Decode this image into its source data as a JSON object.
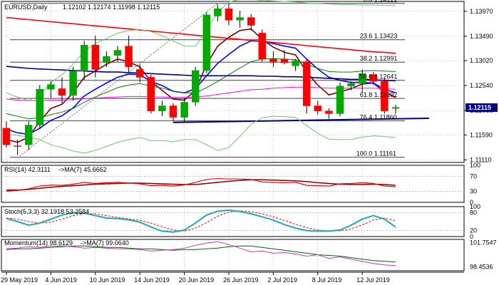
{
  "header": {
    "symbol": "EURUSD,Daily",
    "ohlc": "1.12102 1.12174 1.11998 1.12115"
  },
  "chart_data": {
    "type": "candlestick",
    "main": {
      "ylim": [
        1.1106,
        1.1416
      ],
      "price_ticks": [
        "1.13970",
        "1.13490",
        "1.13020",
        "1.12540",
        "1.12060",
        "1.11590",
        "1.11110"
      ],
      "last_price": "1.12115",
      "fibonacci": [
        {
          "label": "0.0 1.14122",
          "value": 1.14122
        },
        {
          "label": "23.6 1.13423",
          "value": 1.13423
        },
        {
          "label": "38.2 1.12991",
          "value": 1.12991
        },
        {
          "label": "50.0 1.12641",
          "value": 1.12641
        },
        {
          "label": "61.8 1.12292",
          "value": 1.12292
        },
        {
          "label": "76.4 1.11860",
          "value": 1.1186
        },
        {
          "label": "100.0 1.11161",
          "value": 1.11161
        }
      ],
      "candles": [
        {
          "o": 1.1172,
          "h": 1.1185,
          "l": 1.1135,
          "c": 1.114
        },
        {
          "o": 1.1138,
          "h": 1.115,
          "l": 1.112,
          "c": 1.1137
        },
        {
          "o": 1.114,
          "h": 1.1185,
          "l": 1.113,
          "c": 1.1178
        },
        {
          "o": 1.1178,
          "h": 1.1255,
          "l": 1.117,
          "c": 1.1247
        },
        {
          "o": 1.1247,
          "h": 1.1262,
          "l": 1.123,
          "c": 1.1256
        },
        {
          "o": 1.1248,
          "h": 1.127,
          "l": 1.122,
          "c": 1.1235
        },
        {
          "o": 1.1235,
          "h": 1.129,
          "l": 1.1225,
          "c": 1.1282
        },
        {
          "o": 1.1282,
          "h": 1.134,
          "l": 1.1265,
          "c": 1.1332
        },
        {
          "o": 1.1332,
          "h": 1.135,
          "l": 1.127,
          "c": 1.1285
        },
        {
          "o": 1.13,
          "h": 1.132,
          "l": 1.129,
          "c": 1.131
        },
        {
          "o": 1.1312,
          "h": 1.133,
          "l": 1.13,
          "c": 1.1322
        },
        {
          "o": 1.133,
          "h": 1.135,
          "l": 1.128,
          "c": 1.129
        },
        {
          "o": 1.1285,
          "h": 1.1295,
          "l": 1.126,
          "c": 1.127
        },
        {
          "o": 1.127,
          "h": 1.1275,
          "l": 1.12,
          "c": 1.1205
        },
        {
          "o": 1.1205,
          "h": 1.1225,
          "l": 1.1195,
          "c": 1.1215
        },
        {
          "o": 1.1215,
          "h": 1.122,
          "l": 1.1185,
          "c": 1.1193
        },
        {
          "o": 1.1193,
          "h": 1.123,
          "l": 1.1185,
          "c": 1.1222
        },
        {
          "o": 1.1222,
          "h": 1.129,
          "l": 1.1215,
          "c": 1.1283
        },
        {
          "o": 1.1283,
          "h": 1.1395,
          "l": 1.1278,
          "c": 1.139
        },
        {
          "o": 1.1388,
          "h": 1.141,
          "l": 1.1378,
          "c": 1.1402
        },
        {
          "o": 1.1402,
          "h": 1.1412,
          "l": 1.137,
          "c": 1.138
        },
        {
          "o": 1.138,
          "h": 1.1398,
          "l": 1.1365,
          "c": 1.1385
        },
        {
          "o": 1.1385,
          "h": 1.1392,
          "l": 1.136,
          "c": 1.137
        },
        {
          "o": 1.1355,
          "h": 1.1362,
          "l": 1.13,
          "c": 1.1305
        },
        {
          "o": 1.1305,
          "h": 1.132,
          "l": 1.129,
          "c": 1.13
        },
        {
          "o": 1.1305,
          "h": 1.1322,
          "l": 1.1295,
          "c": 1.1298
        },
        {
          "o": 1.1292,
          "h": 1.1305,
          "l": 1.1282,
          "c": 1.1302
        },
        {
          "o": 1.13,
          "h": 1.1305,
          "l": 1.12,
          "c": 1.1215
        },
        {
          "o": 1.1215,
          "h": 1.1225,
          "l": 1.1198,
          "c": 1.1205
        },
        {
          "o": 1.1205,
          "h": 1.121,
          "l": 1.119,
          "c": 1.12
        },
        {
          "o": 1.12,
          "h": 1.126,
          "l": 1.1195,
          "c": 1.1253
        },
        {
          "o": 1.1253,
          "h": 1.1262,
          "l": 1.1245,
          "c": 1.1258
        },
        {
          "o": 1.1258,
          "h": 1.1285,
          "l": 1.124,
          "c": 1.1277
        },
        {
          "o": 1.1275,
          "h": 1.128,
          "l": 1.1255,
          "c": 1.1262
        },
        {
          "o": 1.1262,
          "h": 1.1268,
          "l": 1.12,
          "c": 1.1205
        },
        {
          "o": 1.121,
          "h": 1.1217,
          "l": 1.12,
          "c": 1.1212
        }
      ],
      "lines": [
        {
          "name": "ema5",
          "color": "#800000",
          "values": [
            1.115,
            1.1145,
            1.1155,
            1.1185,
            1.121,
            1.1218,
            1.124,
            1.127,
            1.1282,
            1.1295,
            1.1305,
            1.13,
            1.129,
            1.1262,
            1.1245,
            1.1228,
            1.1226,
            1.1245,
            1.1295,
            1.133,
            1.1347,
            1.136,
            1.1363,
            1.1343,
            1.1328,
            1.1318,
            1.1313,
            1.128,
            1.1255,
            1.1236,
            1.1242,
            1.1248,
            1.1257,
            1.1259,
            1.1241,
            1.1231
          ]
        },
        {
          "name": "ema10",
          "color": "#0000ff",
          "values": [
            1.117,
            1.1163,
            1.116,
            1.1172,
            1.1187,
            1.1196,
            1.1211,
            1.1234,
            1.1247,
            1.1259,
            1.127,
            1.1276,
            1.1275,
            1.1262,
            1.1254,
            1.1243,
            1.124,
            1.1248,
            1.1273,
            1.1297,
            1.1314,
            1.133,
            1.134,
            1.1339,
            1.1335,
            1.133,
            1.1326,
            1.1305,
            1.1286,
            1.127,
            1.1264,
            1.126,
            1.126,
            1.1259,
            1.1247,
            1.124
          ]
        },
        {
          "name": "sma20",
          "color": "#008000",
          "values": [
            1.12,
            1.1195,
            1.119,
            1.1192,
            1.1198,
            1.1203,
            1.121,
            1.1222,
            1.1232,
            1.1241,
            1.125,
            1.1255,
            1.1258,
            1.1253,
            1.1249,
            1.1243,
            1.124,
            1.124,
            1.125,
            1.1262,
            1.1275,
            1.1288,
            1.13,
            1.1305,
            1.1306,
            1.1305,
            1.1304,
            1.1295,
            1.1287,
            1.1281,
            1.128,
            1.128,
            1.1282,
            1.1283,
            1.1282,
            1.1281
          ]
        },
        {
          "name": "ema55",
          "color": "#ff00ff",
          "values": [
            1.1228,
            1.1226,
            1.1225,
            1.1225,
            1.1226,
            1.1226,
            1.1227,
            1.1229,
            1.123,
            1.1231,
            1.1232,
            1.1233,
            1.1233,
            1.1232,
            1.1232,
            1.1231,
            1.1231,
            1.1232,
            1.1234,
            1.1237,
            1.124,
            1.1243,
            1.1246,
            1.1247,
            1.1249,
            1.125,
            1.1251,
            1.1251,
            1.125,
            1.1249,
            1.1249,
            1.1249,
            1.1249,
            1.1249,
            1.1248,
            1.1247
          ]
        },
        {
          "name": "ema100",
          "color": "#000080",
          "values": [
            1.1291,
            1.1289,
            1.1287,
            1.1286,
            1.1285,
            1.1284,
            1.1283,
            1.1282,
            1.1281,
            1.128,
            1.128,
            1.1279,
            1.1278,
            1.1277,
            1.1276,
            1.1275,
            1.1274,
            1.1273,
            1.1273,
            1.1273,
            1.1273,
            1.1273,
            1.1273,
            1.1272,
            1.1272,
            1.1271,
            1.1271,
            1.127,
            1.1269,
            1.1268,
            1.1267,
            1.1266,
            1.1266,
            1.1265,
            1.1264,
            1.1263
          ]
        },
        {
          "name": "ema200",
          "color": "#ff0000",
          "values": [
            1.1385,
            1.1383,
            1.1381,
            1.1379,
            1.1377,
            1.1375,
            1.1373,
            1.1371,
            1.1369,
            1.1367,
            1.1365,
            1.1363,
            1.1361,
            1.1359,
            1.1357,
            1.1355,
            1.1353,
            1.1351,
            1.1349,
            1.1347,
            1.1345,
            1.1343,
            1.1341,
            1.1339,
            1.1337,
            1.1335,
            1.1333,
            1.1331,
            1.1329,
            1.1327,
            1.1325,
            1.1323,
            1.1321,
            1.1319,
            1.1318,
            1.1316
          ]
        },
        {
          "name": "bb-upper",
          "color": "#66cc66",
          "values": [
            1.124,
            1.1232,
            1.1225,
            1.1235,
            1.126,
            1.1275,
            1.1295,
            1.132,
            1.1335,
            1.1345,
            1.1355,
            1.136,
            1.1362,
            1.1358,
            1.135,
            1.134,
            1.133,
            1.133,
            1.136,
            1.1395,
            1.1415,
            1.142,
            1.142,
            1.1418,
            1.1417,
            1.1416,
            1.1415,
            1.1413,
            1.1412,
            1.1411,
            1.141,
            1.141,
            1.1409,
            1.1409,
            1.1408,
            1.1408
          ]
        },
        {
          "name": "bb-lower",
          "color": "#66cc66",
          "values": [
            1.116,
            1.1158,
            1.1155,
            1.115,
            1.114,
            1.1135,
            1.1128,
            1.1124,
            1.1129,
            1.1137,
            1.1145,
            1.115,
            1.1154,
            1.1148,
            1.1148,
            1.1146,
            1.115,
            1.115,
            1.114,
            1.1129,
            1.1135,
            1.1156,
            1.118,
            1.1192,
            1.1195,
            1.1194,
            1.1193,
            1.1177,
            1.1162,
            1.1151,
            1.115,
            1.115,
            1.1155,
            1.1157,
            1.1156,
            1.1154
          ]
        }
      ],
      "trendlines": [
        {
          "name": "support",
          "color": "#000080",
          "from": [
            15,
            1.1183
          ],
          "to": [
            38,
            1.1191
          ]
        },
        {
          "name": "rising-dotted",
          "color": "#666666",
          "from": [
            1,
            1.1115
          ],
          "to": [
            19,
            1.1412
          ]
        }
      ]
    },
    "rsi": {
      "label": "RSI(14) 42.3111",
      "ma_label": "->MA(7) 45.6662",
      "ylim": [
        0,
        100
      ],
      "ticks": [
        "100",
        "70",
        "30",
        "0"
      ],
      "levels": [
        70,
        30
      ],
      "rsi": [
        30,
        32,
        37,
        44,
        47,
        46,
        49,
        54,
        51,
        53,
        54,
        52,
        50,
        45,
        46,
        44,
        47,
        54,
        62,
        64,
        63,
        63,
        62,
        55,
        54,
        53,
        54,
        46,
        45,
        44,
        50,
        51,
        53,
        51,
        44,
        42
      ],
      "ma": [
        33,
        33,
        35,
        38,
        41,
        43,
        45,
        47,
        49,
        50,
        51,
        52,
        52,
        51,
        50,
        49,
        48,
        48,
        51,
        54,
        57,
        59,
        61,
        61,
        60,
        59,
        58,
        56,
        53,
        51,
        49,
        48,
        48,
        49,
        48,
        46
      ]
    },
    "stoch": {
      "label": "Stoch(5,3,3) 32.1918 53.2584",
      "ylim": [
        0,
        100
      ],
      "ticks": [
        "100",
        "80",
        "20",
        "0"
      ],
      "levels": [
        80,
        20
      ],
      "k": [
        60,
        50,
        38,
        45,
        58,
        72,
        80,
        78,
        70,
        62,
        60,
        56,
        48,
        32,
        18,
        15,
        22,
        45,
        72,
        85,
        88,
        84,
        76,
        66,
        55,
        40,
        28,
        20,
        18,
        18,
        22,
        38,
        58,
        70,
        58,
        32
      ],
      "d": [
        62,
        58,
        50,
        45,
        48,
        58,
        70,
        77,
        76,
        70,
        64,
        59,
        54,
        45,
        33,
        22,
        18,
        28,
        47,
        68,
        82,
        86,
        83,
        76,
        66,
        54,
        41,
        30,
        22,
        19,
        19,
        26,
        39,
        55,
        62,
        53
      ]
    },
    "momentum": {
      "label": "Momentum(14) 98.6129",
      "ma_label": "->MA(7) 99.0640",
      "ylim": [
        97.9,
        102.2
      ],
      "ticks": [
        "101.7547",
        "98.4536"
      ],
      "momentum": [
        100.9,
        101.0,
        101.2,
        101.1,
        101.3,
        101.3,
        101.2,
        101.0,
        101.1,
        101.0,
        100.9,
        100.9,
        100.8,
        100.6,
        100.7,
        100.8,
        101.0,
        101.4,
        101.7,
        101.9,
        101.5,
        101.0,
        100.5,
        100.6,
        100.3,
        100.4,
        100.2,
        99.9,
        100.1,
        99.6,
        99.8,
        99.5,
        99.2,
        98.9,
        98.7,
        98.6
      ],
      "ma": [
        100.8,
        100.9,
        100.9,
        101.0,
        101.1,
        101.2,
        101.3,
        101.3,
        101.2,
        101.1,
        101.1,
        101.0,
        100.9,
        100.9,
        100.8,
        100.7,
        100.8,
        100.8,
        100.9,
        101.0,
        101.2,
        101.3,
        101.3,
        101.1,
        100.9,
        100.7,
        100.5,
        100.3,
        100.1,
        100.0,
        99.9,
        99.7,
        99.5,
        99.3,
        99.2,
        99.1
      ]
    },
    "x_labels": [
      {
        "label": "29 May 2019",
        "idx": 0
      },
      {
        "label": "4 Jun 2019",
        "idx": 4
      },
      {
        "label": "10 Jun 2019",
        "idx": 8
      },
      {
        "label": "14 Jun 2019",
        "idx": 12
      },
      {
        "label": "20 Jun 2019",
        "idx": 16
      },
      {
        "label": "26 Jun 2019",
        "idx": 20
      },
      {
        "label": "2 Jul 2019",
        "idx": 24
      },
      {
        "label": "8 Jul 2019",
        "idx": 28
      },
      {
        "label": "12 Jul 2019",
        "idx": 32
      }
    ],
    "colors": {
      "bull": "#00aa00",
      "bear": "#ff0000",
      "rsi_line": "#ff0000",
      "rsi_ma": "#800000",
      "stoch_k": "#20a8b8",
      "stoch_d": "#ff0000",
      "mom_line": "#cc33cc",
      "mom_ma": "#006600",
      "grid": "#808080",
      "last_price_bg": "#000080"
    }
  }
}
